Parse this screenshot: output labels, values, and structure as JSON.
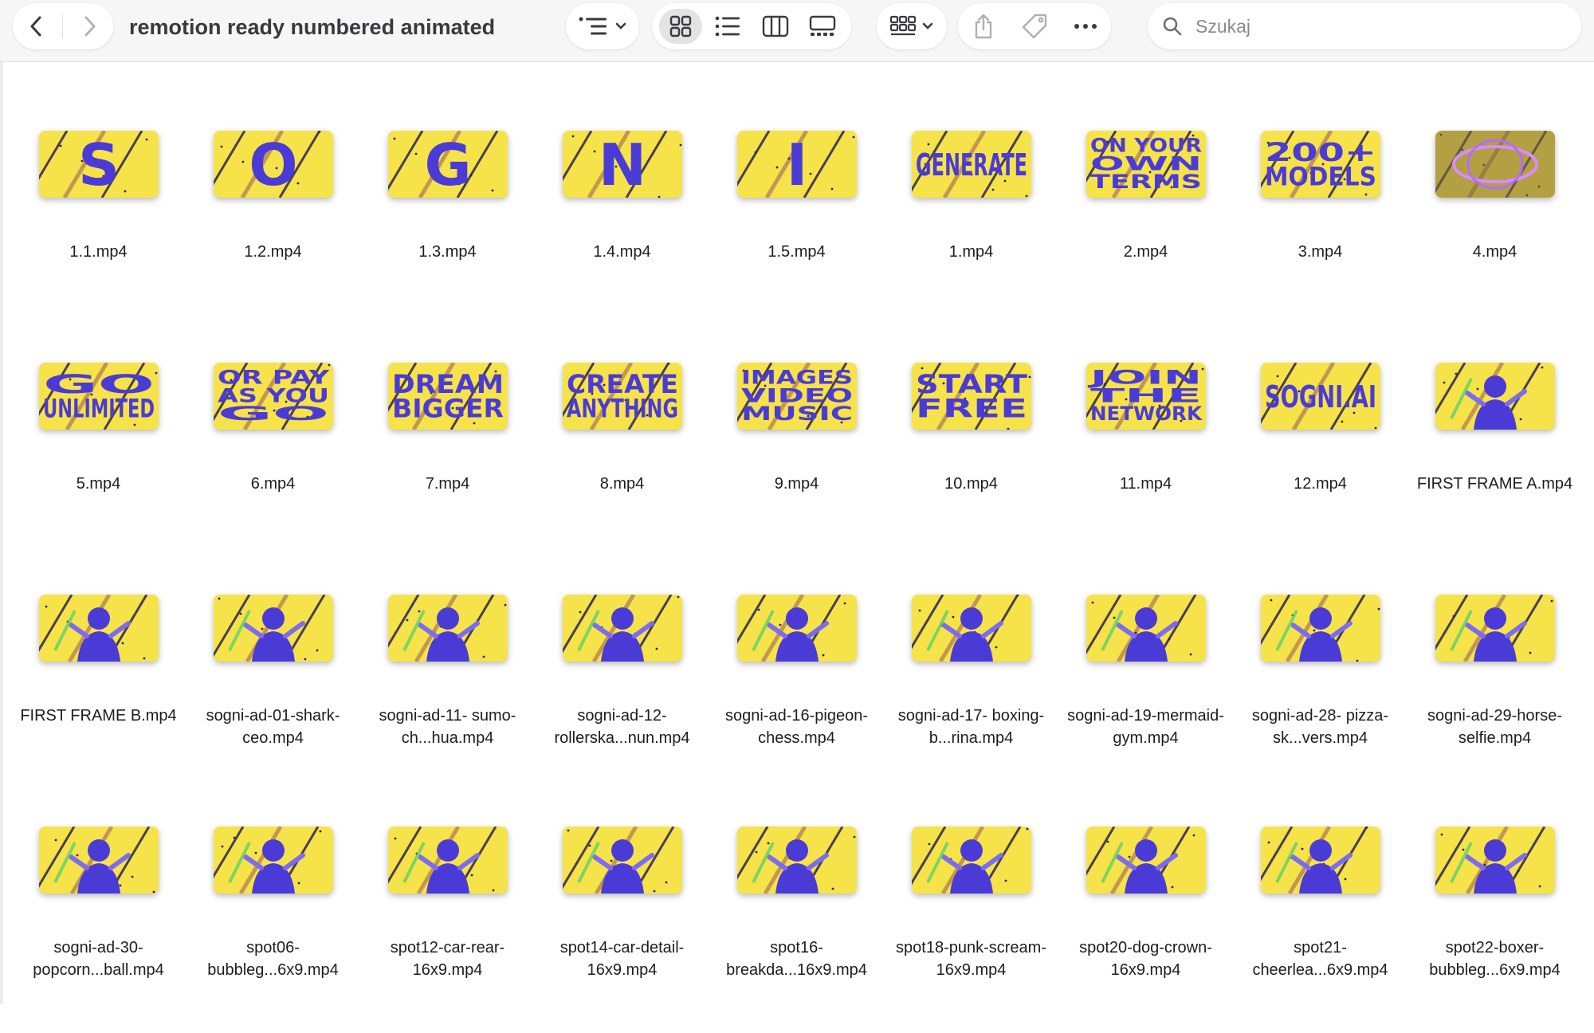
{
  "toolbar": {
    "title": "remotion ready numbered animated",
    "search_placeholder": "Szukaj",
    "active_view": "icons"
  },
  "colors": {
    "thumb_yellow": "#f6e34a",
    "thumb_purple": "#4b3bd6",
    "thumb_dark": "#2b2350",
    "toolbar_bg": "#f6f6f6"
  },
  "files": [
    {
      "name": "1.1.mp4",
      "thumb_text": "S",
      "kind": "letter"
    },
    {
      "name": "1.2.mp4",
      "thumb_text": "O",
      "kind": "letter"
    },
    {
      "name": "1.3.mp4",
      "thumb_text": "G",
      "kind": "letter"
    },
    {
      "name": "1.4.mp4",
      "thumb_text": "N",
      "kind": "letter"
    },
    {
      "name": "1.5.mp4",
      "thumb_text": "I",
      "kind": "letter"
    },
    {
      "name": "1.mp4",
      "thumb_text": "GENERATE",
      "kind": "text"
    },
    {
      "name": "2.mp4",
      "thumb_text": "ON YOUR|OWN|TERMS",
      "kind": "text"
    },
    {
      "name": "3.mp4",
      "thumb_text": "200+|MODELS",
      "kind": "text"
    },
    {
      "name": "4.mp4",
      "thumb_text": "",
      "kind": "glow"
    },
    {
      "name": "5.mp4",
      "thumb_text": "GO|UNLIMITED",
      "kind": "text"
    },
    {
      "name": "6.mp4",
      "thumb_text": "OR PAY|AS YOU|GO",
      "kind": "text"
    },
    {
      "name": "7.mp4",
      "thumb_text": "DREAM|BIGGER",
      "kind": "text"
    },
    {
      "name": "8.mp4",
      "thumb_text": "CREATE|ANYTHING",
      "kind": "text"
    },
    {
      "name": "9.mp4",
      "thumb_text": "IMAGES|VIDEO|MUSIC",
      "kind": "text"
    },
    {
      "name": "10.mp4",
      "thumb_text": "START|FREE",
      "kind": "text"
    },
    {
      "name": "11.mp4",
      "thumb_text": "JOIN|THE|NETWORK",
      "kind": "text"
    },
    {
      "name": "12.mp4",
      "thumb_text": "SOGNI.AI",
      "kind": "text"
    },
    {
      "name": "FIRST FRAME A.mp4",
      "thumb_text": "",
      "kind": "image"
    },
    {
      "name": "FIRST FRAME B.mp4",
      "thumb_text": "",
      "kind": "image"
    },
    {
      "name": "sogni-ad-01-shark-ceo.mp4",
      "thumb_text": "",
      "kind": "image"
    },
    {
      "name": "sumo-ch...hua.mp4",
      "prefix": "sogni-ad-11-",
      "thumb_text": "",
      "kind": "image"
    },
    {
      "name": "rollerska...nun.mp4",
      "prefix": "sogni-ad-12-",
      "thumb_text": "",
      "kind": "image"
    },
    {
      "name": "sogni-ad-16-pigeon-chess.mp4",
      "thumb_text": "",
      "kind": "image"
    },
    {
      "name": "boxing-b...rina.mp4",
      "prefix": "sogni-ad-17-",
      "thumb_text": "",
      "kind": "image"
    },
    {
      "name": "sogni-ad-19-mermaid-gym.mp4",
      "thumb_text": "",
      "kind": "image"
    },
    {
      "name": "pizza-sk...vers.mp4",
      "prefix": "sogni-ad-28-",
      "thumb_text": "",
      "kind": "image"
    },
    {
      "name": "sogni-ad-29-horse-selfie.mp4",
      "thumb_text": "",
      "kind": "image"
    },
    {
      "name": "popcorn...ball.mp4",
      "prefix": "sogni-ad-30-",
      "thumb_text": "",
      "kind": "image"
    },
    {
      "name": "bubbleg...6x9.mp4",
      "prefix": "spot06-",
      "thumb_text": "",
      "kind": "image"
    },
    {
      "name": "spot12-car-rear-16x9.mp4",
      "thumb_text": "",
      "kind": "image"
    },
    {
      "name": "spot14-car-detail-16x9.mp4",
      "thumb_text": "",
      "kind": "image"
    },
    {
      "name": "breakda...16x9.mp4",
      "prefix": "spot16-",
      "thumb_text": "",
      "kind": "image"
    },
    {
      "name": "spot18-punk-scream-16x9.mp4",
      "thumb_text": "",
      "kind": "image"
    },
    {
      "name": "spot20-dog-crown-16x9.mp4",
      "thumb_text": "",
      "kind": "image"
    },
    {
      "name": "cheerlea...6x9.mp4",
      "prefix": "spot21-",
      "thumb_text": "",
      "kind": "image"
    },
    {
      "name": "bubbleg...6x9.mp4",
      "prefix": "spot22-boxer-",
      "thumb_text": "",
      "kind": "image"
    }
  ]
}
